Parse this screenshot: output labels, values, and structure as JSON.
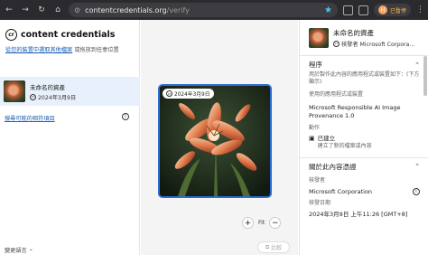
{
  "browser": {
    "url_host": "contentcredentials.org",
    "url_path": "/verify",
    "profile_label": "已暫停",
    "avatar_initial": "H"
  },
  "left": {
    "logo_text": "content credentials",
    "logo_mark": "cr",
    "hint_link": "從您的裝置中選取其他檔案",
    "hint_rest": " 或拖放到任意位置",
    "asset": {
      "name": "未命名的資產",
      "date": "2024年3月9日"
    },
    "search_link": "搜尋可能的相符項目",
    "footer_link": "變更語言"
  },
  "center": {
    "image_badge": "2024年3月9日",
    "zoom_in": "+",
    "fit_label": "Fit",
    "zoom_out": "−",
    "compare_label": "比較"
  },
  "right": {
    "asset_title": "未命名的資產",
    "signed_by": "核發者 Microsoft Corpora...",
    "process_heading": "程序",
    "process_desc": "用於製作此內容的應用程式或裝置如下：(下方顯示)",
    "app_label": "使用的應用程式或裝置",
    "app_value": "Microsoft Responsible AI Image Provenance 1.0",
    "actions_label": "動作",
    "action_name": "已建立",
    "action_desc": "建立了新的檔案或內容",
    "about_heading": "關於此內容憑證",
    "issuer_label": "核發者",
    "issuer_value": "Microsoft Corporation",
    "date_label": "核發日期",
    "date_value": "2024年3月9日 上午11:26 [GMT+8]"
  }
}
